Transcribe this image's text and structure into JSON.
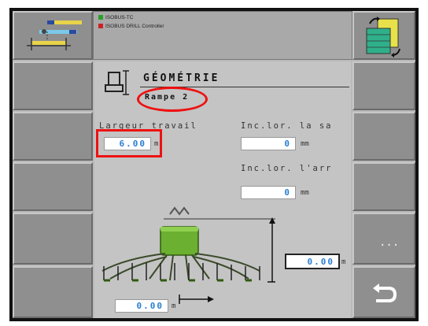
{
  "header": {
    "line1": "ISOBUS-TC",
    "line2": "ISOBUS DRILL Controller"
  },
  "page": {
    "title": "GÉOMÉTRIE",
    "subtitle": "Rampe 2"
  },
  "fields": {
    "working_width_label": "Largeur travail",
    "working_width_value": "6.00",
    "working_width_unit": "m",
    "lateral_offset_front_label": "Inc.lor. la sa",
    "lateral_offset_front_value": "0",
    "lateral_offset_front_unit": "mm",
    "lateral_offset_rear_label": "Inc.lor. l'arr",
    "lateral_offset_rear_value": "0",
    "lateral_offset_rear_unit": "mm",
    "boom_height_value": "0.00",
    "boom_height_unit": "m",
    "boom_offset_value": "0.00",
    "boom_offset_unit": "m"
  },
  "softkeys": {
    "more_label": "...",
    "back_icon": "return-arrow-icon"
  },
  "colors": {
    "value_text": "#2b7fd0",
    "highlight": "#e11111",
    "implement_green": "#6bb030"
  }
}
